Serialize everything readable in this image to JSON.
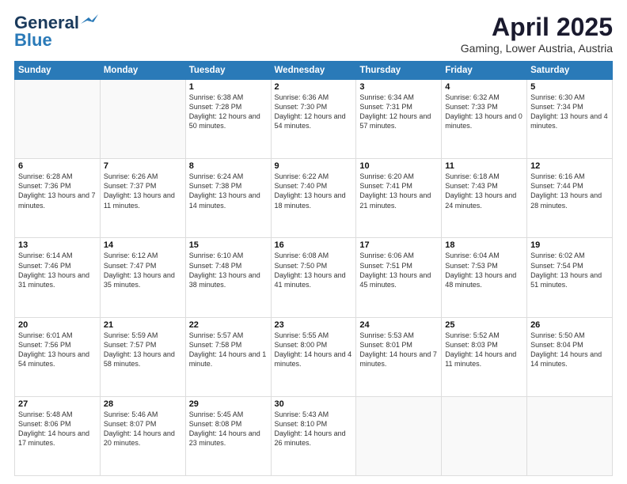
{
  "header": {
    "logo_line1": "General",
    "logo_line2": "Blue",
    "month_title": "April 2025",
    "subtitle": "Gaming, Lower Austria, Austria"
  },
  "days_of_week": [
    "Sunday",
    "Monday",
    "Tuesday",
    "Wednesday",
    "Thursday",
    "Friday",
    "Saturday"
  ],
  "weeks": [
    [
      {
        "day": "",
        "info": ""
      },
      {
        "day": "",
        "info": ""
      },
      {
        "day": "1",
        "info": "Sunrise: 6:38 AM\nSunset: 7:28 PM\nDaylight: 12 hours\nand 50 minutes."
      },
      {
        "day": "2",
        "info": "Sunrise: 6:36 AM\nSunset: 7:30 PM\nDaylight: 12 hours\nand 54 minutes."
      },
      {
        "day": "3",
        "info": "Sunrise: 6:34 AM\nSunset: 7:31 PM\nDaylight: 12 hours\nand 57 minutes."
      },
      {
        "day": "4",
        "info": "Sunrise: 6:32 AM\nSunset: 7:33 PM\nDaylight: 13 hours\nand 0 minutes."
      },
      {
        "day": "5",
        "info": "Sunrise: 6:30 AM\nSunset: 7:34 PM\nDaylight: 13 hours\nand 4 minutes."
      }
    ],
    [
      {
        "day": "6",
        "info": "Sunrise: 6:28 AM\nSunset: 7:36 PM\nDaylight: 13 hours\nand 7 minutes."
      },
      {
        "day": "7",
        "info": "Sunrise: 6:26 AM\nSunset: 7:37 PM\nDaylight: 13 hours\nand 11 minutes."
      },
      {
        "day": "8",
        "info": "Sunrise: 6:24 AM\nSunset: 7:38 PM\nDaylight: 13 hours\nand 14 minutes."
      },
      {
        "day": "9",
        "info": "Sunrise: 6:22 AM\nSunset: 7:40 PM\nDaylight: 13 hours\nand 18 minutes."
      },
      {
        "day": "10",
        "info": "Sunrise: 6:20 AM\nSunset: 7:41 PM\nDaylight: 13 hours\nand 21 minutes."
      },
      {
        "day": "11",
        "info": "Sunrise: 6:18 AM\nSunset: 7:43 PM\nDaylight: 13 hours\nand 24 minutes."
      },
      {
        "day": "12",
        "info": "Sunrise: 6:16 AM\nSunset: 7:44 PM\nDaylight: 13 hours\nand 28 minutes."
      }
    ],
    [
      {
        "day": "13",
        "info": "Sunrise: 6:14 AM\nSunset: 7:46 PM\nDaylight: 13 hours\nand 31 minutes."
      },
      {
        "day": "14",
        "info": "Sunrise: 6:12 AM\nSunset: 7:47 PM\nDaylight: 13 hours\nand 35 minutes."
      },
      {
        "day": "15",
        "info": "Sunrise: 6:10 AM\nSunset: 7:48 PM\nDaylight: 13 hours\nand 38 minutes."
      },
      {
        "day": "16",
        "info": "Sunrise: 6:08 AM\nSunset: 7:50 PM\nDaylight: 13 hours\nand 41 minutes."
      },
      {
        "day": "17",
        "info": "Sunrise: 6:06 AM\nSunset: 7:51 PM\nDaylight: 13 hours\nand 45 minutes."
      },
      {
        "day": "18",
        "info": "Sunrise: 6:04 AM\nSunset: 7:53 PM\nDaylight: 13 hours\nand 48 minutes."
      },
      {
        "day": "19",
        "info": "Sunrise: 6:02 AM\nSunset: 7:54 PM\nDaylight: 13 hours\nand 51 minutes."
      }
    ],
    [
      {
        "day": "20",
        "info": "Sunrise: 6:01 AM\nSunset: 7:56 PM\nDaylight: 13 hours\nand 54 minutes."
      },
      {
        "day": "21",
        "info": "Sunrise: 5:59 AM\nSunset: 7:57 PM\nDaylight: 13 hours\nand 58 minutes."
      },
      {
        "day": "22",
        "info": "Sunrise: 5:57 AM\nSunset: 7:58 PM\nDaylight: 14 hours\nand 1 minute."
      },
      {
        "day": "23",
        "info": "Sunrise: 5:55 AM\nSunset: 8:00 PM\nDaylight: 14 hours\nand 4 minutes."
      },
      {
        "day": "24",
        "info": "Sunrise: 5:53 AM\nSunset: 8:01 PM\nDaylight: 14 hours\nand 7 minutes."
      },
      {
        "day": "25",
        "info": "Sunrise: 5:52 AM\nSunset: 8:03 PM\nDaylight: 14 hours\nand 11 minutes."
      },
      {
        "day": "26",
        "info": "Sunrise: 5:50 AM\nSunset: 8:04 PM\nDaylight: 14 hours\nand 14 minutes."
      }
    ],
    [
      {
        "day": "27",
        "info": "Sunrise: 5:48 AM\nSunset: 8:06 PM\nDaylight: 14 hours\nand 17 minutes."
      },
      {
        "day": "28",
        "info": "Sunrise: 5:46 AM\nSunset: 8:07 PM\nDaylight: 14 hours\nand 20 minutes."
      },
      {
        "day": "29",
        "info": "Sunrise: 5:45 AM\nSunset: 8:08 PM\nDaylight: 14 hours\nand 23 minutes."
      },
      {
        "day": "30",
        "info": "Sunrise: 5:43 AM\nSunset: 8:10 PM\nDaylight: 14 hours\nand 26 minutes."
      },
      {
        "day": "",
        "info": ""
      },
      {
        "day": "",
        "info": ""
      },
      {
        "day": "",
        "info": ""
      }
    ]
  ]
}
